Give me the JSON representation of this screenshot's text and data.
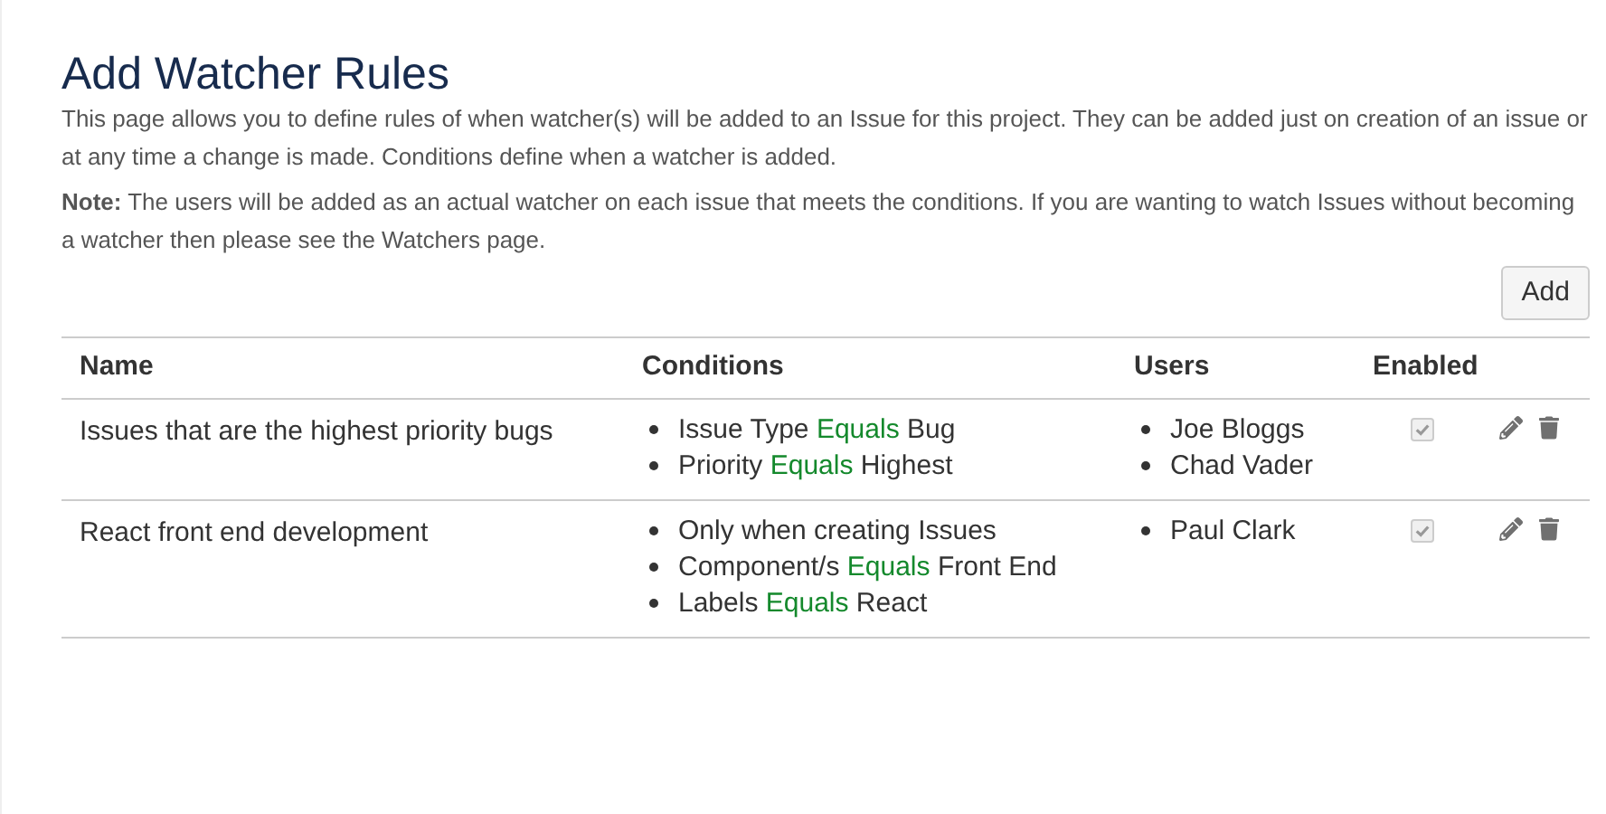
{
  "page": {
    "title": "Add Watcher Rules",
    "description": "This page allows you to define rules of when watcher(s) will be added to an Issue for this project. They can be added just on creation of an issue or at any time a change is made. Conditions define when a watcher is added.",
    "note": "**Note:** The users will be added as an actual watcher on each issue that meets the conditions. If you are wanting to watch Issues without becoming a watcher then please see the Watchers page.",
    "add_button": "Add"
  },
  "table": {
    "columns": [
      "Name",
      "Conditions",
      "Users",
      "Enabled"
    ],
    "rows": [
      {
        "name": "Issues that are the highest priority bugs",
        "conditions": [
          {
            "kind": "match",
            "field": "Issue Type",
            "operator": "Equals",
            "value": "Bug"
          },
          {
            "kind": "match",
            "field": "Priority",
            "operator": "Equals",
            "value": "Highest"
          }
        ],
        "users": [
          "Joe Bloggs",
          "Chad Vader"
        ],
        "enabled": true,
        "disabled": true
      },
      {
        "name": "React front end development",
        "conditions": [
          {
            "kind": "text",
            "text": "Only when creating Issues"
          },
          {
            "kind": "match",
            "field": "Component/s",
            "operator": "Equals",
            "value": "Front End"
          },
          {
            "kind": "match",
            "field": "Labels",
            "operator": "Equals",
            "value": "React"
          }
        ],
        "users": [
          "Paul Clark"
        ],
        "enabled": true,
        "disabled": true
      }
    ]
  }
}
